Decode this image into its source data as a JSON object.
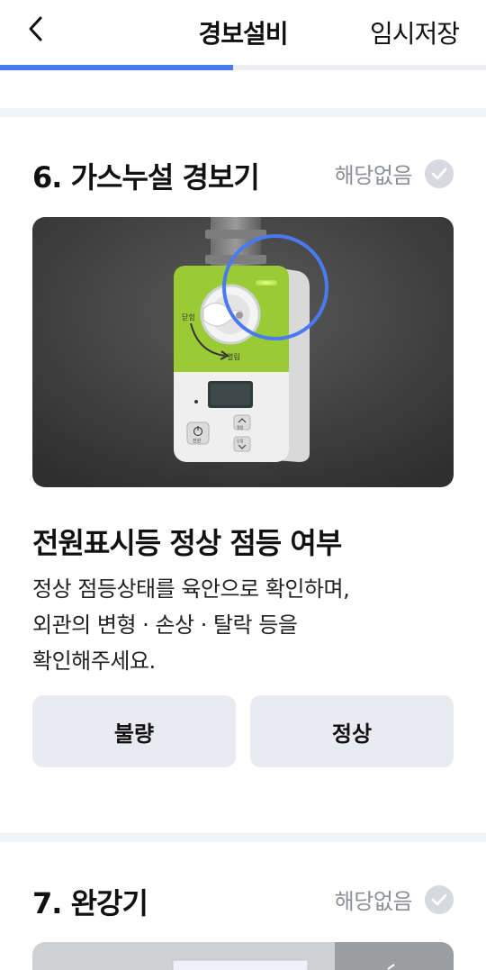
{
  "header": {
    "title": "경보설비",
    "save_label": "임시저장",
    "progress": 0.48
  },
  "sections": [
    {
      "title": "6. 가스누설 경보기",
      "na_label": "해당없음",
      "device_labels": {
        "close": "닫힘",
        "open": "열림",
        "power": "전원",
        "up": "열림",
        "down": "닫힘"
      },
      "question": "전원표시등 정상 점등 여부",
      "description": [
        "정상 점등상태를 육안으로 확인하며,",
        "외관의 변형 · 손상 · 탈락 등을",
        "확인해주세요."
      ],
      "buttons": {
        "bad": "불량",
        "good": "정상"
      }
    },
    {
      "title": "7. 완강기",
      "na_label": "해당없음"
    }
  ],
  "colors": {
    "accent": "#4a7af0",
    "device_green": "#9acb35",
    "check_gray": "#d6d9df"
  }
}
